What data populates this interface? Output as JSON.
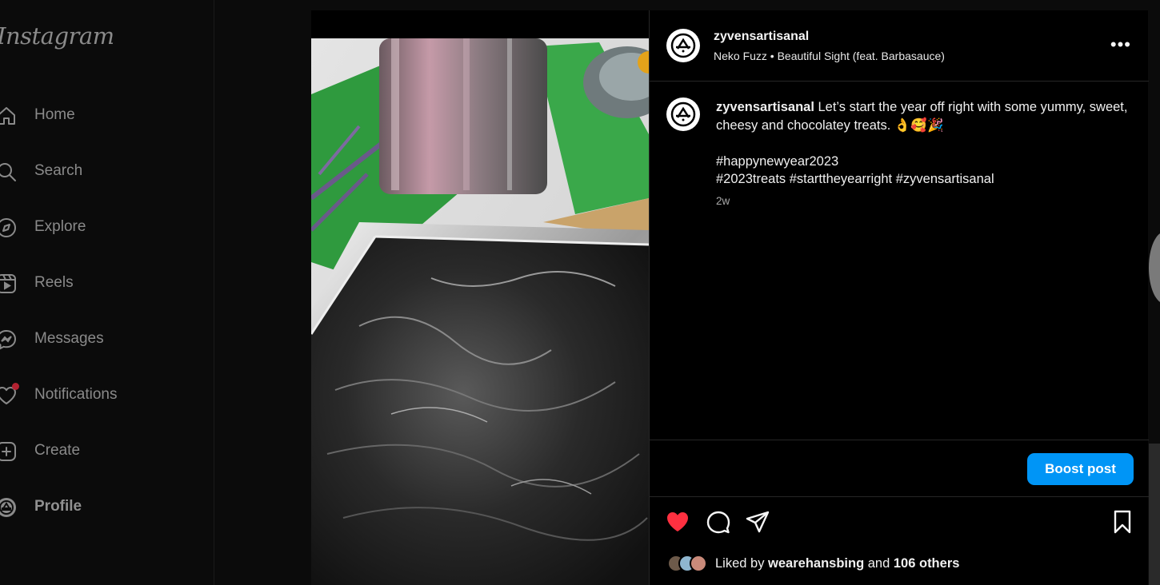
{
  "app": {
    "logo_text": "Instagram"
  },
  "sidebar": {
    "items": [
      {
        "label": "Home",
        "icon": "home-icon"
      },
      {
        "label": "Search",
        "icon": "search-icon"
      },
      {
        "label": "Explore",
        "icon": "compass-icon"
      },
      {
        "label": "Reels",
        "icon": "reels-icon"
      },
      {
        "label": "Messages",
        "icon": "messenger-icon"
      },
      {
        "label": "Notifications",
        "icon": "heart-icon"
      },
      {
        "label": "Create",
        "icon": "plus-square-icon"
      },
      {
        "label": "Profile",
        "icon": "profile-avatar-icon"
      }
    ]
  },
  "post": {
    "username": "zyvensartisanal",
    "audio": "Neko Fuzz • Beautiful Sight (feat. Barbasauce)",
    "caption_username": "zyvensartisanal",
    "caption_line1": " Let’s start the year off right with some yummy, sweet, cheesy and chocolatey treats. 👌🥰🎉",
    "hashtags_line1": "#happynewyear2023",
    "hashtags_line2": "#2023treats #starttheyearright #zyvensartisanal",
    "time_ago": "2w",
    "boost_label": "Boost post",
    "likes_prefix": "Liked by ",
    "likes_user": "wearehansbing",
    "likes_middle": " and ",
    "likes_others": "106 others",
    "more_glyph": "•••"
  },
  "colors": {
    "accent": "#0095f6",
    "like_red": "#ff3040",
    "notification_dot": "#b32231"
  }
}
